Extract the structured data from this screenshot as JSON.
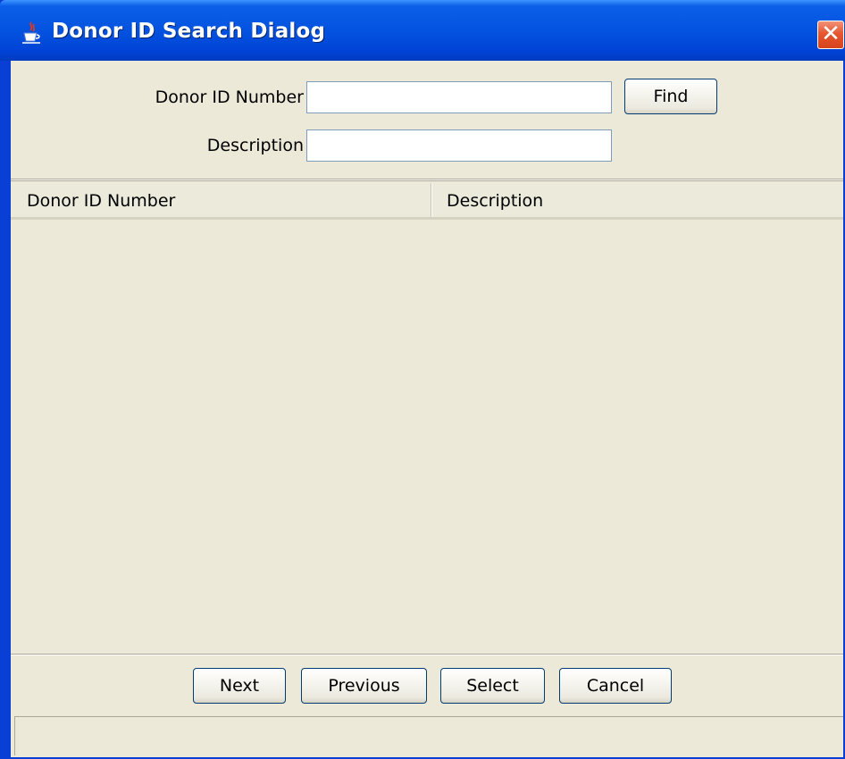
{
  "window": {
    "title": "Donor ID Search Dialog",
    "close_symbol": "✕",
    "title_icon": "java-cup-icon",
    "accent_color": "#0a3fd6",
    "close_color": "#d8431c"
  },
  "search": {
    "donor_id_label": "Donor ID Number",
    "donor_id_value": "",
    "description_label": "Description",
    "description_value": "",
    "find_label": "Find"
  },
  "table": {
    "columns": [
      "Donor ID Number",
      "Description"
    ],
    "rows": []
  },
  "buttons": {
    "next": "Next",
    "previous": "Previous",
    "select": "Select",
    "cancel": "Cancel"
  },
  "status": {
    "text": ""
  }
}
